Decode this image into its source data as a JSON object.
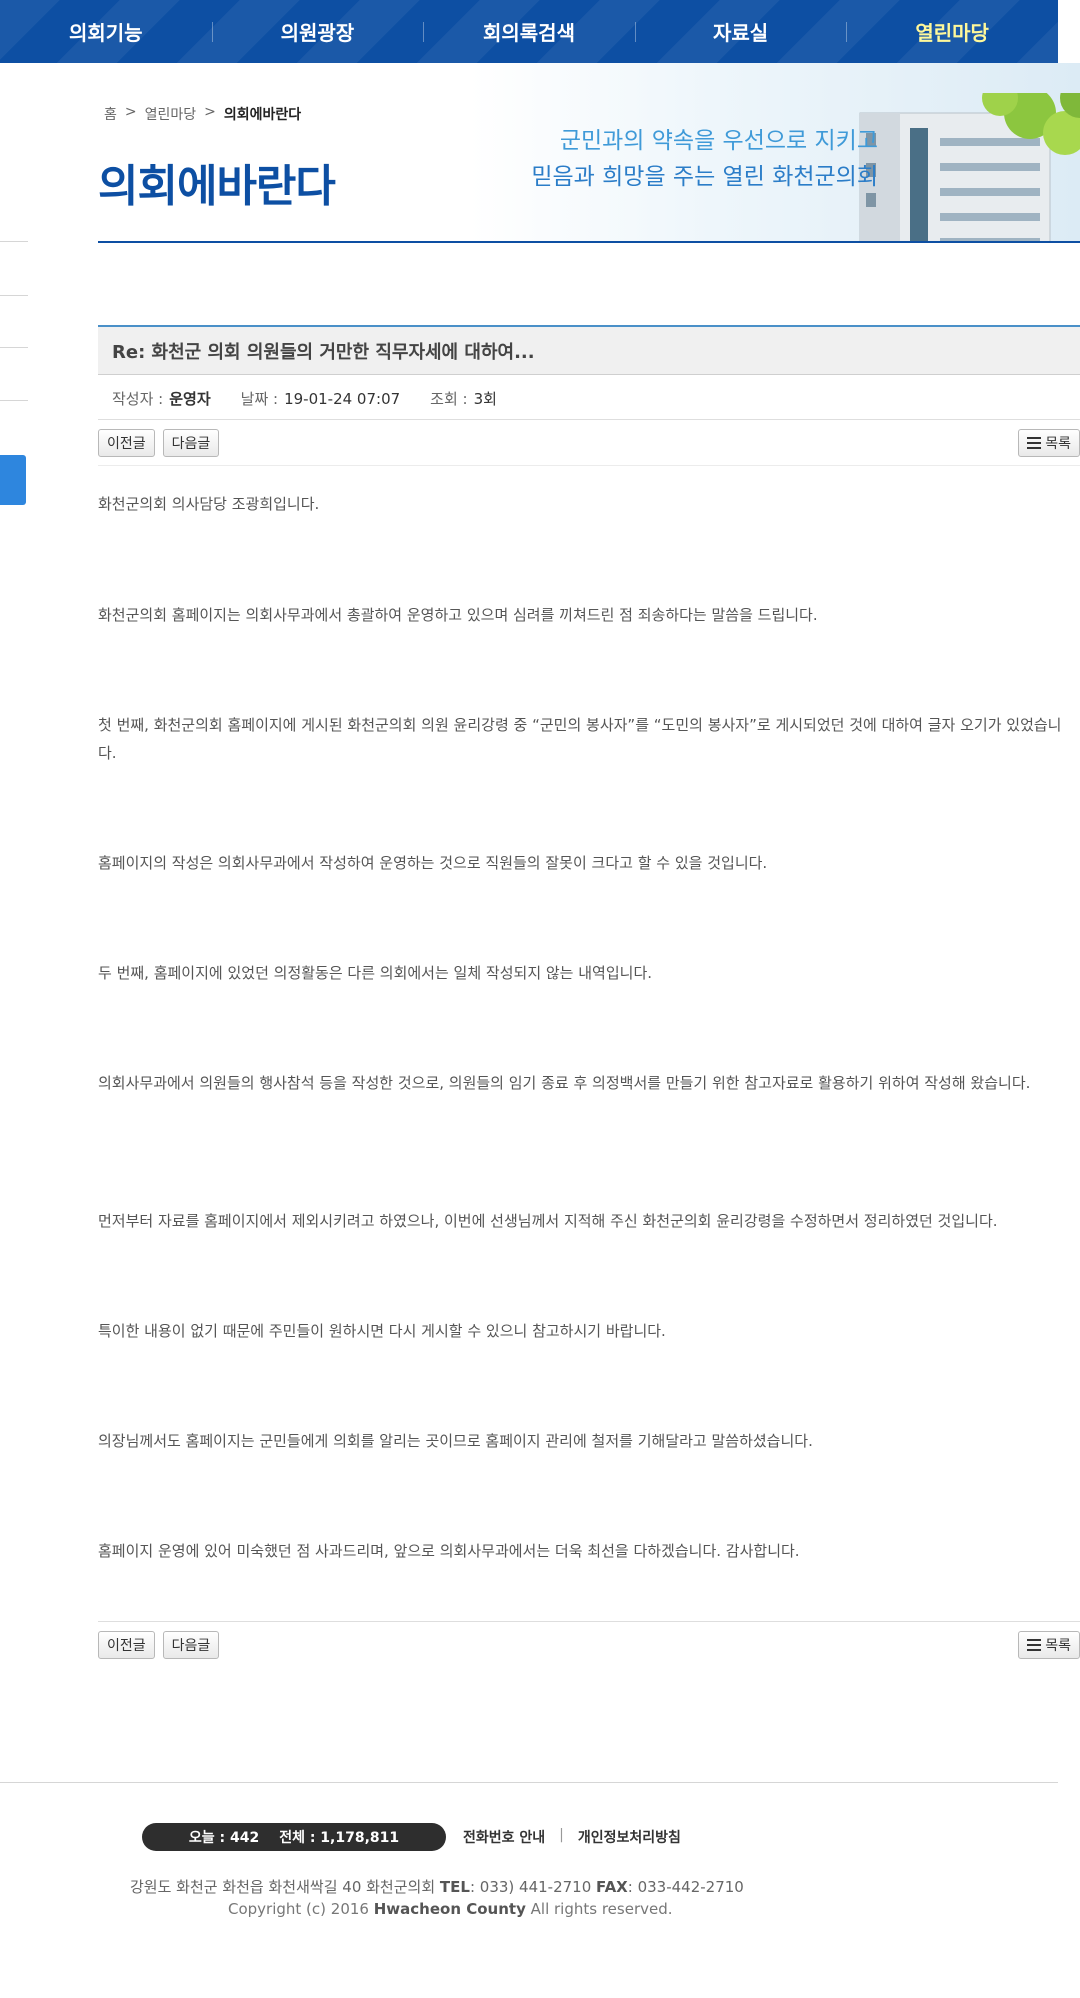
{
  "nav": {
    "items": [
      {
        "label": "의회기능"
      },
      {
        "label": "의원광장"
      },
      {
        "label": "회의록검색"
      },
      {
        "label": "자료실"
      },
      {
        "label": "열린마당"
      }
    ],
    "active_index": 4,
    "active_color": "#fff89a",
    "background_color": "#0d4fa3"
  },
  "banner": {
    "slogan_line1": "군민과의 약속을 우선으로 지키고",
    "slogan_line2": "믿음과 희망을 주는 열린 화천군의회"
  },
  "breadcrumb": {
    "home": "홈",
    "separator": ">",
    "section": "열린마당",
    "current": "의회에바란다"
  },
  "page_title": "의회에바란다",
  "post": {
    "subject": "Re: 화천군 의회 의원들의 거만한 직무자세에 대하여...",
    "author_label": "작성자 :",
    "author": "운영자",
    "date_label": "날짜 :",
    "date": "19-01-24 07:07",
    "views_label": "조회 :",
    "views": "3회",
    "paragraphs": [
      "화천군의회 의사담당 조광희입니다.",
      "  화천군의회 홈페이지는 의회사무과에서 총괄하여 운영하고 있으며 심려를 끼쳐드린 점 죄송하다는 말씀을 드립니다.",
      "  첫 번째, 화천군의회 홈페이지에 게시된 화천군의회 의원 윤리강령 중 “군민의 봉사자”를 “도민의 봉사자”로 게시되었던 것에 대하여 글자 오기가 있었습니다.",
      "  홈페이지의 작성은 의회사무과에서 작성하여 운영하는 것으로 직원들의 잘못이 크다고 할 수 있을 것입니다.",
      "  두 번째, 홈페이지에 있었던 의정활동은 다른 의회에서는 일체 작성되지 않는 내역입니다.",
      "  의회사무과에서 의원들의 행사참석 등을 작성한 것으로, 의원들의 임기 종료 후 의정백서를 만들기 위한 참고자료로 활용하기 위하여 작성해 왔습니다.",
      "  먼저부터 자료를 홈페이지에서 제외시키려고 하였으나, 이번에 선생님께서 지적해 주신 화천군의회 윤리강령을 수정하면서 정리하였던 것입니다.",
      "  특이한 내용이 없기 때문에 주민들이 원하시면 다시 게시할 수 있으니 참고하시기 바랍니다.",
      "  의장님께서도 홈페이지는 군민들에게 의회를 알리는 곳이므로 홈페이지 관리에 철저를 기해달라고 말씀하셨습니다.",
      "  홈페이지 운영에 있어 미숙했던 점 사과드리며, 앞으로 의회사무과에서는 더욱 최선을 다하겠습니다. 감사합니다."
    ]
  },
  "buttons": {
    "prev": "이전글",
    "next": "다음글",
    "list": "목록"
  },
  "footer": {
    "today_label": "오늘 : 442",
    "total_label": "전체 : 1,178,811",
    "link_phone": "전화번호 안내",
    "link_sep": "|",
    "link_privacy": "개인정보처리방침",
    "address": "강원도 화천군 화천읍 화천새싹길 40 화천군의회",
    "tel_label": "TEL",
    "tel": ": 033) 441-2710",
    "fax_label": "FAX",
    "fax": ": 033-442-2710",
    "copyright_prefix": "Copyright (c) 2016",
    "copyright_org": "Hwacheon County",
    "copyright_suffix": "All rights reserved."
  }
}
